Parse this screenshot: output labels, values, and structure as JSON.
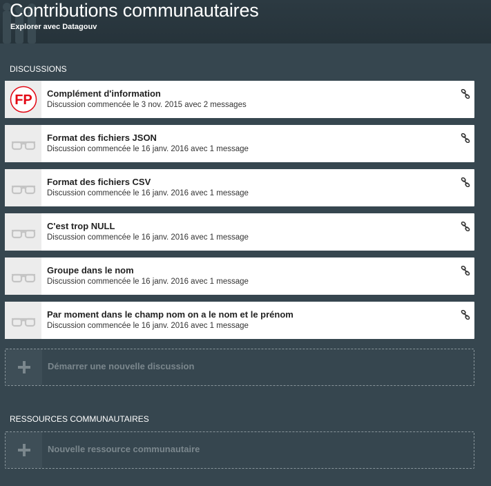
{
  "header": {
    "title": "Contributions communautaires",
    "subtitle": "Explorer avec Datagouv"
  },
  "discussions": {
    "heading": "DISCUSSIONS",
    "items": [
      {
        "title": "Complément d'information",
        "meta": "Discussion commencée le 3 nov. 2015 avec 2 messages",
        "avatar": "fp-logo"
      },
      {
        "title": "Format des fichiers JSON",
        "meta": "Discussion commencée le 16 janv. 2016 avec 1 message",
        "avatar": "glasses-icon"
      },
      {
        "title": "Format des fichiers CSV",
        "meta": "Discussion commencée le 16 janv. 2016 avec 1 message",
        "avatar": "glasses-icon"
      },
      {
        "title": "C'est trop NULL",
        "meta": "Discussion commencée le 16 janv. 2016 avec 1 message",
        "avatar": "glasses-icon"
      },
      {
        "title": "Groupe dans le nom",
        "meta": "Discussion commencée le 16 janv. 2016 avec 1 message",
        "avatar": "glasses-icon"
      },
      {
        "title": "Par moment dans le champ nom on a le nom et le prénom",
        "meta": "Discussion commencée le 16 janv. 2016 avec 1 message",
        "avatar": "glasses-icon"
      }
    ],
    "new_label": "Démarrer une nouvelle discussion"
  },
  "resources": {
    "heading": "RESSOURCES COMMUNAUTAIRES",
    "new_label": "Nouvelle ressource communautaire"
  },
  "colors": {
    "background": "#36464f",
    "header": "#2a373e",
    "card": "#ffffff",
    "fp_red": "#e30613"
  }
}
